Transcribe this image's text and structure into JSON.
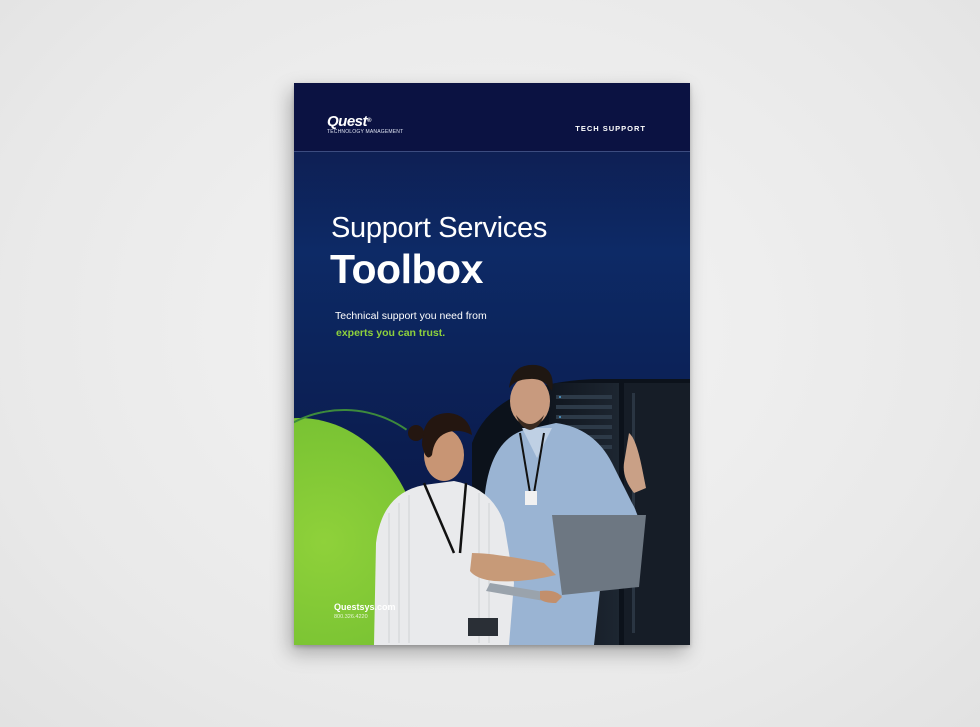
{
  "brochure": {
    "logo": {
      "name": "Quest",
      "registered_mark": "®",
      "subtitle": "Technology Management"
    },
    "category_tag": "TECH SUPPORT",
    "title_line_1": "Support Services",
    "title_line_2": "Toolbox",
    "subtitle_line_1": "Technical support you need from",
    "subtitle_line_2": "experts you can trust.",
    "website": "Questsys.com",
    "phone": "800.326.4220"
  },
  "colors": {
    "navy": "#0b1242",
    "deep_blue": "#0d2a66",
    "accent_green": "#8ed13c"
  },
  "icons": {
    "photo": "technicians-with-laptop-in-server-room"
  }
}
